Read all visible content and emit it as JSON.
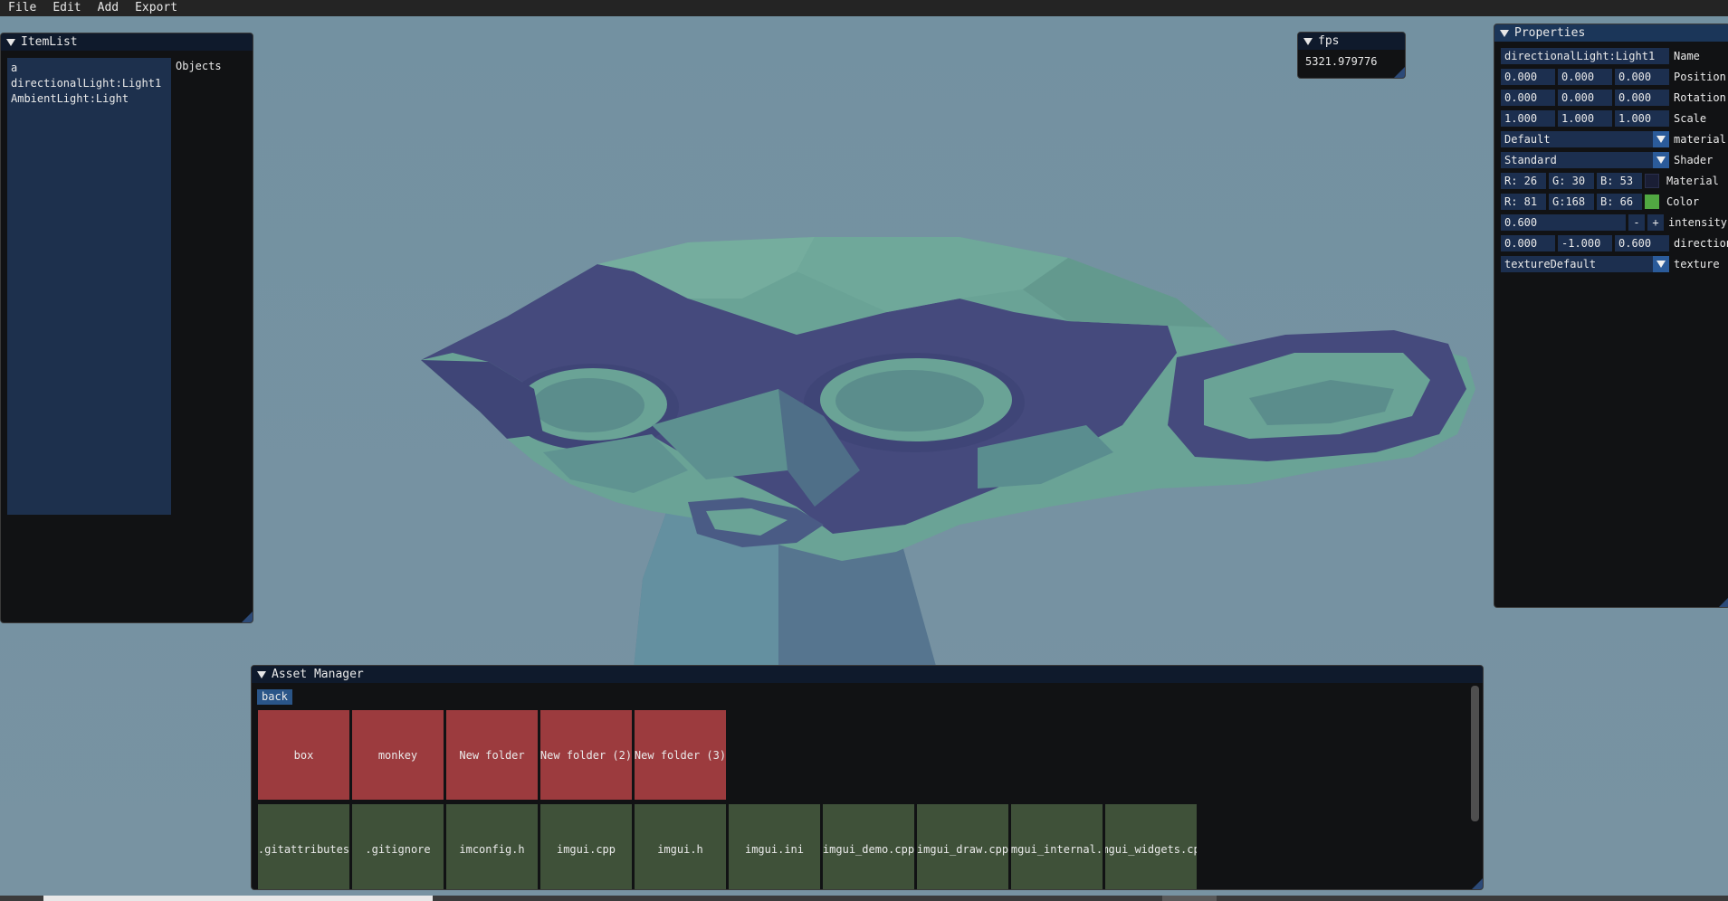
{
  "menu": [
    "File",
    "Edit",
    "Add",
    "Export"
  ],
  "itemlist": {
    "title": "ItemList",
    "items": [
      "a",
      "directionalLight:Light1",
      "AmbientLight:Light"
    ],
    "objects_label": "Objects"
  },
  "fps": {
    "title": "fps",
    "value": "5321.979776"
  },
  "properties": {
    "title": "Properties",
    "name_value": "directionalLight:Light1",
    "name_label": "Name",
    "position": [
      "0.000",
      "0.000",
      "0.000"
    ],
    "position_label": "Position",
    "rotation": [
      "0.000",
      "0.000",
      "0.000"
    ],
    "rotation_label": "Rotation",
    "scale": [
      "1.000",
      "1.000",
      "1.000"
    ],
    "scale_label": "Scale",
    "material_value": "Default",
    "material_label": "material",
    "shader_value": "Standard",
    "shader_label": "Shader",
    "material_color": [
      "R: 26",
      "G: 30",
      "B: 53"
    ],
    "material_color_label": "Material",
    "material_swatch": "#1a1e35",
    "light_color": [
      "R: 81",
      "G:168",
      "B: 66"
    ],
    "light_color_label": "Color",
    "light_swatch": "#51a842",
    "intensity_value": "0.600",
    "intensity_minus": "-",
    "intensity_plus": "+",
    "intensity_label": "intensity",
    "direction": [
      "0.000",
      "-1.000",
      "0.600"
    ],
    "direction_label": "direction",
    "texture_value": "textureDefault",
    "texture_label": "texture"
  },
  "asset_manager": {
    "title": "Asset Manager",
    "back_label": "back",
    "folders": [
      "box",
      "monkey",
      "New folder",
      "New folder (2)",
      "New folder (3)"
    ],
    "files": [
      ".gitattributes",
      ".gitignore",
      "imconfig.h",
      "imgui.cpp",
      "imgui.h",
      "imgui.ini",
      "imgui_demo.cpp",
      "imgui_draw.cpp",
      "imgui_internal.h",
      "imgui_widgets.cpp"
    ]
  },
  "colors": {
    "viewport_bg": "#7590a0",
    "folder_tile": "#9c3b3e",
    "file_tile": "#3f5139",
    "accent": "#2b5b9a",
    "mesh_light": "#6aa396",
    "mesh_dark": "#454a7d"
  }
}
